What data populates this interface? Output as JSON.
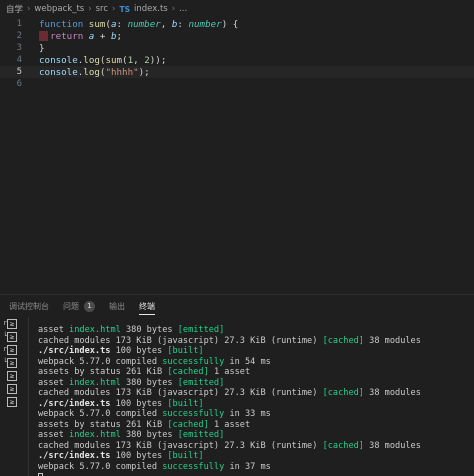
{
  "breadcrumb": {
    "items": [
      "自学",
      "webpack_ts",
      "src",
      "index.ts",
      "..."
    ],
    "ts_badge": "TS"
  },
  "editor": {
    "current_line": 5,
    "lines": [
      {
        "num": "1",
        "fold": "",
        "tokens": [
          {
            "t": "function ",
            "c": "kwb"
          },
          {
            "t": "sum",
            "c": "fn"
          },
          {
            "t": "(",
            "c": ""
          },
          {
            "t": "a",
            "c": "pr"
          },
          {
            "t": ": ",
            "c": ""
          },
          {
            "t": "number",
            "c": "ty"
          },
          {
            "t": ", ",
            "c": ""
          },
          {
            "t": "b",
            "c": "pr"
          },
          {
            "t": ": ",
            "c": ""
          },
          {
            "t": "number",
            "c": "ty"
          },
          {
            "t": ") {",
            "c": ""
          }
        ]
      },
      {
        "num": "2",
        "fold": "",
        "breakpoint": true,
        "tokens": [
          {
            "t": "  return ",
            "c": "kw"
          },
          {
            "t": "a",
            "c": "pr"
          },
          {
            "t": " + ",
            "c": ""
          },
          {
            "t": "b",
            "c": "pr"
          },
          {
            "t": ";",
            "c": ""
          }
        ]
      },
      {
        "num": "3",
        "fold": "",
        "tokens": [
          {
            "t": "}",
            "c": ""
          }
        ]
      },
      {
        "num": "4",
        "fold": "",
        "tokens": [
          {
            "t": "console",
            "c": "var"
          },
          {
            "t": ".",
            "c": ""
          },
          {
            "t": "log",
            "c": "fn"
          },
          {
            "t": "(",
            "c": ""
          },
          {
            "t": "sum",
            "c": "fn"
          },
          {
            "t": "(",
            "c": ""
          },
          {
            "t": "1",
            "c": "num"
          },
          {
            "t": ", ",
            "c": ""
          },
          {
            "t": "2",
            "c": "num"
          },
          {
            "t": "));",
            "c": ""
          }
        ]
      },
      {
        "num": "5",
        "fold": "",
        "tokens": [
          {
            "t": "console",
            "c": "var"
          },
          {
            "t": ".",
            "c": ""
          },
          {
            "t": "log",
            "c": "fn"
          },
          {
            "t": "(",
            "c": ""
          },
          {
            "t": "\"hhhh\"",
            "c": "str"
          },
          {
            "t": ");",
            "c": ""
          }
        ]
      },
      {
        "num": "6",
        "fold": "",
        "tokens": []
      }
    ]
  },
  "panel": {
    "tabs": [
      {
        "label": "调试控制台",
        "active": false
      },
      {
        "label": "问题",
        "active": false,
        "badge": "1"
      },
      {
        "label": "输出",
        "active": false
      },
      {
        "label": "终端",
        "active": true
      }
    ],
    "terminal_icons": [
      {
        "prefix": "r",
        "glyph": "≥"
      },
      {
        "prefix": "└",
        "glyph": "≥"
      },
      {
        "prefix": "r",
        "glyph": "≥"
      },
      {
        "prefix": "└",
        "glyph": "≥"
      },
      {
        "prefix": "",
        "glyph": "≥"
      },
      {
        "prefix": "",
        "glyph": "≥"
      },
      {
        "prefix": "",
        "glyph": "≥"
      }
    ],
    "terminal_lines": [
      [
        {
          "t": "asset ",
          "c": ""
        },
        {
          "t": "index.html",
          "c": "g"
        },
        {
          "t": " 380 bytes ",
          "c": ""
        },
        {
          "t": "[emitted]",
          "c": "g"
        }
      ],
      [
        {
          "t": "cached modules 173 KiB (javascript) 27.3 KiB (runtime) ",
          "c": ""
        },
        {
          "t": "[cached]",
          "c": "g"
        },
        {
          "t": " 38 modules",
          "c": ""
        }
      ],
      [
        {
          "t": "./src/index.ts",
          "c": "b"
        },
        {
          "t": " 100 bytes ",
          "c": ""
        },
        {
          "t": "[built]",
          "c": "g"
        }
      ],
      [
        {
          "t": "webpack 5.77.0 compiled ",
          "c": ""
        },
        {
          "t": "successfully",
          "c": "g"
        },
        {
          "t": " in 54 ms",
          "c": ""
        }
      ],
      [
        {
          "t": "assets by status 261 KiB ",
          "c": ""
        },
        {
          "t": "[cached]",
          "c": "g"
        },
        {
          "t": " 1 asset",
          "c": ""
        }
      ],
      [
        {
          "t": "asset ",
          "c": ""
        },
        {
          "t": "index.html",
          "c": "g"
        },
        {
          "t": " 380 bytes ",
          "c": ""
        },
        {
          "t": "[emitted]",
          "c": "g"
        }
      ],
      [
        {
          "t": "cached modules 173 KiB (javascript) 27.3 KiB (runtime) ",
          "c": ""
        },
        {
          "t": "[cached]",
          "c": "g"
        },
        {
          "t": " 38 modules",
          "c": ""
        }
      ],
      [
        {
          "t": "./src/index.ts",
          "c": "b"
        },
        {
          "t": " 100 bytes ",
          "c": ""
        },
        {
          "t": "[built]",
          "c": "g"
        }
      ],
      [
        {
          "t": "webpack 5.77.0 compiled ",
          "c": ""
        },
        {
          "t": "successfully",
          "c": "g"
        },
        {
          "t": " in 33 ms",
          "c": ""
        }
      ],
      [
        {
          "t": "assets by status 261 KiB ",
          "c": ""
        },
        {
          "t": "[cached]",
          "c": "g"
        },
        {
          "t": " 1 asset",
          "c": ""
        }
      ],
      [
        {
          "t": "asset ",
          "c": ""
        },
        {
          "t": "index.html",
          "c": "g"
        },
        {
          "t": " 380 bytes ",
          "c": ""
        },
        {
          "t": "[emitted]",
          "c": "g"
        }
      ],
      [
        {
          "t": "cached modules 173 KiB (javascript) 27.3 KiB (runtime) ",
          "c": ""
        },
        {
          "t": "[cached]",
          "c": "g"
        },
        {
          "t": " 38 modules",
          "c": ""
        }
      ],
      [
        {
          "t": "./src/index.ts",
          "c": "b"
        },
        {
          "t": " 100 bytes ",
          "c": ""
        },
        {
          "t": "[built]",
          "c": "g"
        }
      ],
      [
        {
          "t": "webpack 5.77.0 compiled ",
          "c": ""
        },
        {
          "t": "successfully",
          "c": "g"
        },
        {
          "t": " in 37 ms",
          "c": ""
        }
      ]
    ]
  },
  "colors": {
    "background": "#1f1f1f",
    "keyword": "#569cd6",
    "function": "#dcdcaa",
    "string": "#ce9178",
    "number": "#b5cea8",
    "type": "#4ec9b0",
    "success_green": "#23d18b",
    "breakpoint": "#6b2b33"
  }
}
